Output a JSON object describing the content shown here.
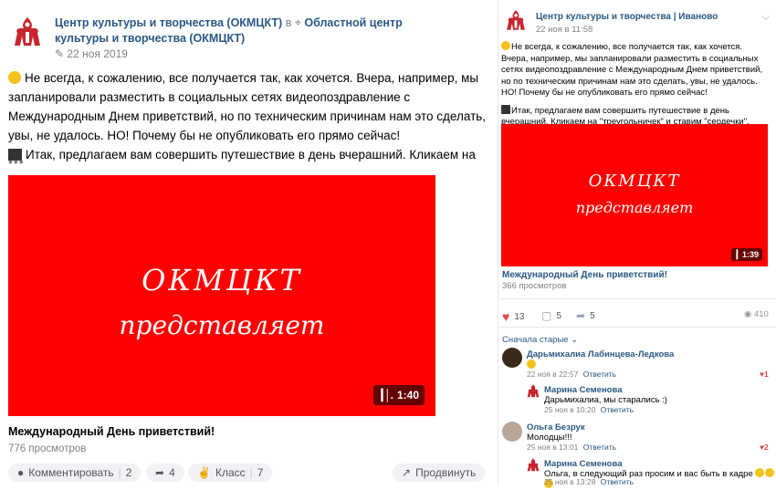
{
  "main_post": {
    "group_name": "Центр культуры и творчества (ОКМЦКТ)",
    "in_word": "в",
    "location_name": "Областной центр культуры и творчества (ОКМЦКТ)",
    "date": "22 ноя 2019",
    "line1": "Не всегда, к сожалению, все получается так, как хочется. Вчера, например, мы запланировали разместить в социальных сетях видеопоздравление с Международным Днем приветствий, но по техническим причинам нам это сделать, увы, не удалось. НО! Почему бы не опубликовать его прямо сейчас!",
    "line2": "Итак, предлагаем вам совершить путешествие в день вчерашний. Кликаем на",
    "more": "•••",
    "video": {
      "overlay_line1": "ОКМЦКТ",
      "overlay_line2": "представляет",
      "duration": "1:40",
      "caption": "Международный День приветствий!",
      "views": "776 просмотров"
    },
    "actions": {
      "comment_label": "Комментировать",
      "comment_count": "2",
      "share_count": "4",
      "class_label": "Класс",
      "class_count": "7",
      "promote_label": "Продвинуть"
    }
  },
  "side_post": {
    "group_name": "Центр культуры и творчества | Иваново",
    "date": "22 ноя в 11:58",
    "para1": "Не всегда, к сожалению, все получается так, как хочется. Вчера, например, мы запланировали разместить в социальных сетях видеопоздравление с Международным Днем приветствий, но по техническим причинам нам это сделать, увы, не удалось. НО! Почему бы не опубликовать его прямо сейчас!",
    "para2": "Итак, предлагаем вам совершить путешествие в день вчерашний. Кликаем на \"треугольничек\" и ставим \"сердечки\".",
    "video": {
      "overlay_line1": "ОКМЦКТ",
      "overlay_line2": "представляет",
      "duration": "1:39",
      "caption": "Международный День приветствий!",
      "views": "366 просмотров"
    },
    "likes": "13",
    "comments": "5",
    "shares": "5",
    "views": "410",
    "sort_label": "Сначала старые",
    "comments_list": [
      {
        "name": "Дарьмихалиа Лабинцева-Ледкова",
        "text": "",
        "date": "22 ноя в 22:57",
        "reply": "Ответить",
        "likes": "1"
      },
      {
        "name": "Марина Семенова",
        "text": "Дарьмихалиа, мы старались :)",
        "date": "25 ноя в 10:20",
        "reply": "Ответить",
        "likes": ""
      },
      {
        "name": "Ольга Безрук",
        "text": "Молодцы!!!",
        "date": "25 ноя в 13:01",
        "reply": "Ответить",
        "likes": "2"
      },
      {
        "name": "Марина Семенова",
        "text": "Ольга, в следующий раз просим и вас быть в кадре",
        "date": "25 ноя в 13:28",
        "reply": "Ответить",
        "likes": ""
      }
    ]
  },
  "colors": {
    "video_bg": "#fe0000",
    "link": "#2a5885",
    "like_red": "#e64646"
  }
}
